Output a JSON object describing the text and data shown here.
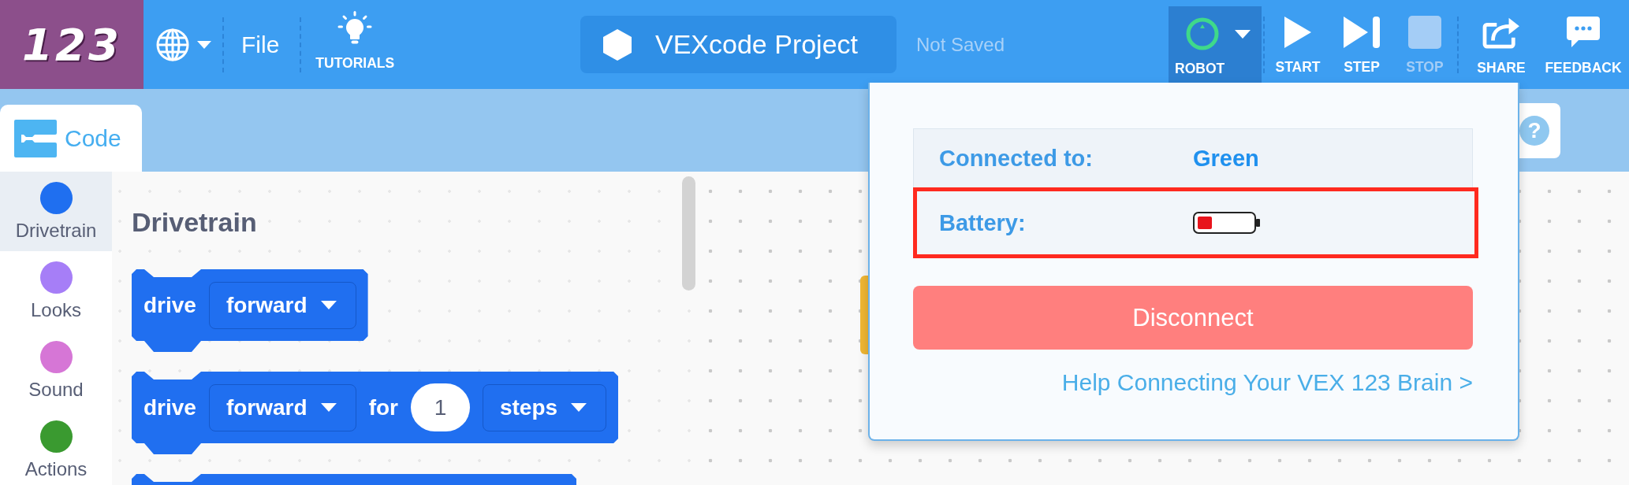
{
  "header": {
    "logo": "123",
    "file_menu": "File",
    "tutorials": "TUTORIALS",
    "project_name": "VEXcode Project",
    "save_status": "Not Saved"
  },
  "robot_button": {
    "label": "ROBOT",
    "expanded": true,
    "connected": true
  },
  "toolbar": [
    {
      "kind": "start",
      "label": "START",
      "disabled": false
    },
    {
      "kind": "step",
      "label": "STEP",
      "disabled": false
    },
    {
      "kind": "stop",
      "label": "STOP",
      "disabled": true
    },
    {
      "kind": "share",
      "label": "SHARE",
      "disabled": false
    },
    {
      "kind": "feedback",
      "label": "FEEDBACK",
      "disabled": false
    }
  ],
  "tabs": [
    {
      "label": "Code",
      "selected": true
    }
  ],
  "help_button": "?",
  "categories": [
    {
      "label": "Drivetrain",
      "color": "#1f6ff0",
      "selected": true
    },
    {
      "label": "Looks",
      "color": "#a67ef7",
      "selected": false
    },
    {
      "label": "Sound",
      "color": "#d676d6",
      "selected": false
    },
    {
      "label": "Actions",
      "color": "#3a9a30",
      "selected": false
    }
  ],
  "palette": {
    "heading": "Drivetrain",
    "blocks": [
      {
        "kind": "command",
        "parts": [
          {
            "kind": "text",
            "text": "drive"
          },
          {
            "kind": "dropdown",
            "text": "forward"
          }
        ]
      },
      {
        "kind": "command",
        "parts": [
          {
            "kind": "text",
            "text": "drive"
          },
          {
            "kind": "dropdown",
            "text": "forward"
          },
          {
            "kind": "text",
            "text": "for"
          },
          {
            "kind": "number",
            "text": "1"
          },
          {
            "kind": "dropdown",
            "text": "steps"
          }
        ]
      },
      {
        "kind": "partial"
      }
    ]
  },
  "popup": {
    "rows": [
      {
        "kind": "text",
        "label": "Connected to:",
        "value": "Green",
        "highlighted": false
      },
      {
        "kind": "battery",
        "label": "Battery:",
        "highlighted": true
      }
    ],
    "button": "Disconnect",
    "help_link": "Help Connecting Your VEX 123 Brain >"
  }
}
